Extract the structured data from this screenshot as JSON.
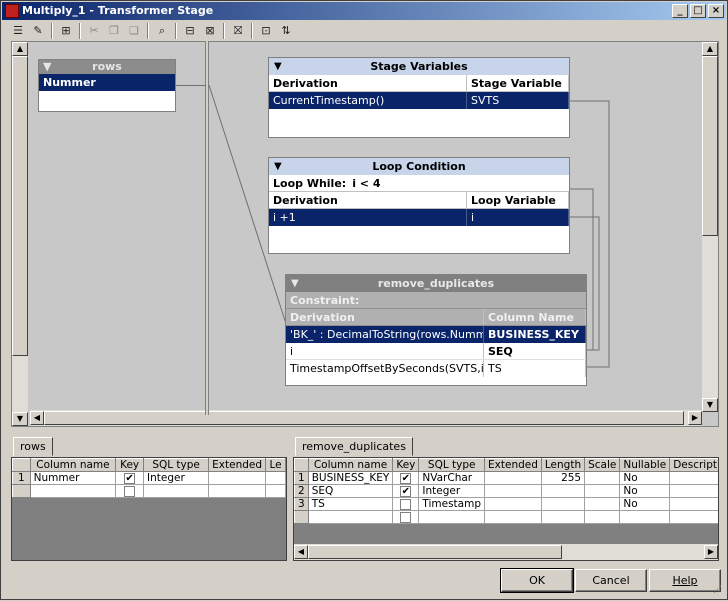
{
  "window": {
    "title": "Multiply_1 - Transformer Stage",
    "controls": [
      "_",
      "□",
      "×"
    ]
  },
  "toolbar": {
    "tools": [
      "☰",
      "✎",
      "⊞",
      "✂",
      "❐",
      "❏",
      "⌕",
      "⊟",
      "⊠",
      "⛝",
      "⊡",
      "⇅"
    ]
  },
  "rows_link": {
    "title": "rows",
    "column": "Nummer"
  },
  "stage_variables": {
    "title": "Stage Variables",
    "headers": [
      "Derivation",
      "Stage Variable"
    ],
    "rows": [
      {
        "derivation": "CurrentTimestamp()",
        "name": "SVTS"
      }
    ]
  },
  "loop_condition": {
    "title": "Loop Condition",
    "loop_while_label": "Loop While:",
    "loop_while_value": "i < 4",
    "headers": [
      "Derivation",
      "Loop Variable"
    ],
    "rows": [
      {
        "derivation": "i +1",
        "name": "i"
      }
    ]
  },
  "output_link": {
    "title": "remove_duplicates",
    "constraint_label": "Constraint:",
    "headers": [
      "Derivation",
      "Column Name"
    ],
    "rows": [
      {
        "derivation": "'BK_' : DecimalToString(rows.Nummer)",
        "name": "BUSINESS_KEY"
      },
      {
        "derivation": "i",
        "name": "SEQ"
      },
      {
        "derivation": "TimestampOffsetBySeconds(SVTS,i)",
        "name": "TS"
      }
    ]
  },
  "left_grid": {
    "tab": "rows",
    "headers": [
      "",
      "Column name",
      "Key",
      "SQL type",
      "Extended",
      "Le"
    ],
    "rows": [
      {
        "num": "1",
        "name": "Nummer",
        "key": "✔",
        "type": "Integer",
        "extended": "",
        "length": ""
      },
      {
        "num": "",
        "name": "",
        "key": "",
        "type": "",
        "extended": "",
        "length": ""
      }
    ]
  },
  "right_grid": {
    "tab": "remove_duplicates",
    "headers": [
      "",
      "Column name",
      "Key",
      "SQL type",
      "Extended",
      "Length",
      "Scale",
      "Nullable",
      "Description"
    ],
    "rows": [
      {
        "num": "1",
        "name": "BUSINESS_KEY",
        "key": "✔",
        "type": "NVarChar",
        "extended": "",
        "length": "255",
        "scale": "",
        "nullable": "No",
        "desc": ""
      },
      {
        "num": "2",
        "name": "SEQ",
        "key": "✔",
        "type": "Integer",
        "extended": "",
        "length": "",
        "scale": "",
        "nullable": "No",
        "desc": ""
      },
      {
        "num": "3",
        "name": "TS",
        "key": "",
        "type": "Timestamp",
        "extended": "",
        "length": "",
        "scale": "",
        "nullable": "No",
        "desc": ""
      },
      {
        "num": "",
        "name": "",
        "key": "",
        "type": "",
        "extended": "",
        "length": "",
        "scale": "",
        "nullable": "",
        "desc": ""
      }
    ]
  },
  "buttons": {
    "ok": "OK",
    "cancel": "Cancel",
    "help": "Help"
  },
  "icons": {
    "collapse": "▼",
    "up": "▲",
    "down": "▼",
    "left": "◀",
    "right": "▶"
  }
}
